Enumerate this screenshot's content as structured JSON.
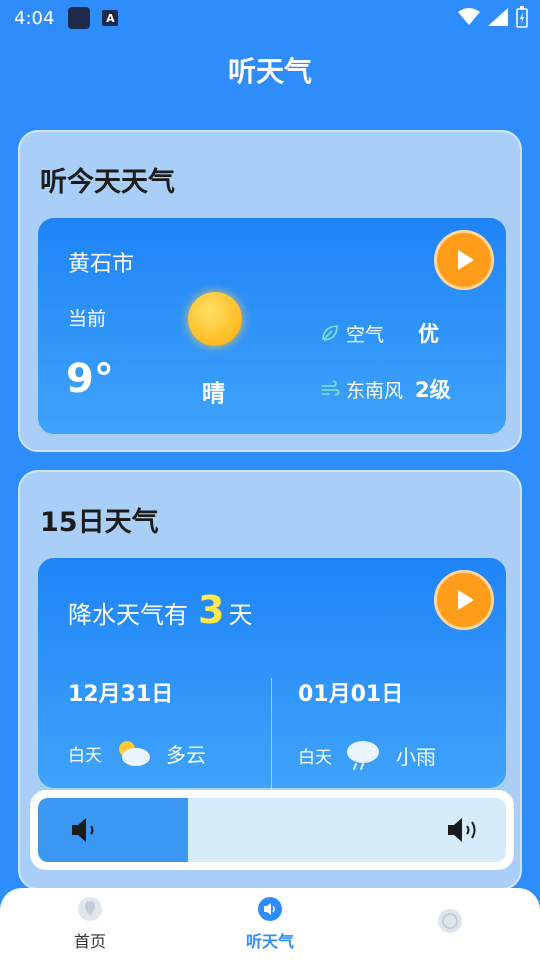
{
  "status_bar": {
    "time": "4:04",
    "a_label": "A"
  },
  "app": {
    "title": "听天气"
  },
  "today_card": {
    "title": "听今天天气",
    "city": "黄石市",
    "current_label": "当前",
    "temperature": "9°",
    "condition": "晴",
    "air_label": "空气",
    "air_value": "优",
    "wind_label": "东南风",
    "wind_value": "2级"
  },
  "forecast_card": {
    "title": "15日天气",
    "rain_prefix": "降水天气有",
    "rain_days": "3",
    "rain_suffix": "天",
    "days": [
      {
        "date": "12月31日",
        "period": "白天",
        "weather": "多云",
        "icon": "partly-cloudy-icon"
      },
      {
        "date": "01月01日",
        "period": "白天",
        "weather": "小雨",
        "icon": "light-rain-icon"
      }
    ]
  },
  "volume": {
    "level_percent": 32
  },
  "bottom_nav": {
    "items": [
      {
        "label": "首页",
        "icon": "location-pin-icon",
        "active": false
      },
      {
        "label": "听天气",
        "icon": "speaker-icon",
        "active": true
      },
      {
        "label": "",
        "icon": "compass-icon",
        "active": false
      }
    ]
  },
  "colors": {
    "background": "#2f8dfb",
    "accent_orange": "#ff9d1b",
    "highlight_yellow": "#ffe84a"
  }
}
